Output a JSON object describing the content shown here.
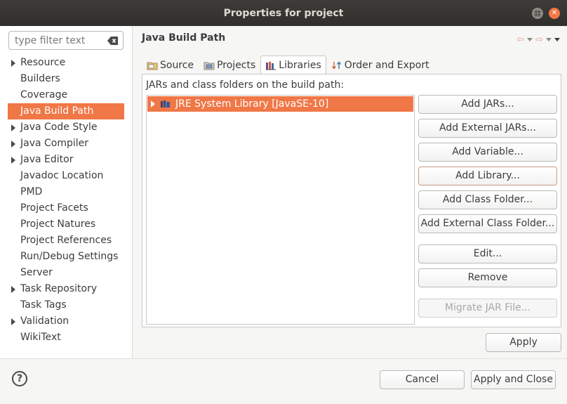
{
  "window": {
    "title": "Properties for project"
  },
  "filter": {
    "placeholder": "type filter text"
  },
  "nav": {
    "items": [
      {
        "label": "Resource",
        "expandable": true
      },
      {
        "label": "Builders",
        "expandable": false
      },
      {
        "label": "Coverage",
        "expandable": false
      },
      {
        "label": "Java Build Path",
        "expandable": false,
        "selected": true
      },
      {
        "label": "Java Code Style",
        "expandable": true
      },
      {
        "label": "Java Compiler",
        "expandable": true
      },
      {
        "label": "Java Editor",
        "expandable": true
      },
      {
        "label": "Javadoc Location",
        "expandable": false
      },
      {
        "label": "PMD",
        "expandable": false
      },
      {
        "label": "Project Facets",
        "expandable": false
      },
      {
        "label": "Project Natures",
        "expandable": false
      },
      {
        "label": "Project References",
        "expandable": false
      },
      {
        "label": "Run/Debug Settings",
        "expandable": false
      },
      {
        "label": "Server",
        "expandable": false
      },
      {
        "label": "Task Repository",
        "expandable": true
      },
      {
        "label": "Task Tags",
        "expandable": false
      },
      {
        "label": "Validation",
        "expandable": true
      },
      {
        "label": "WikiText",
        "expandable": false
      }
    ]
  },
  "page": {
    "title": "Java Build Path"
  },
  "tabs": {
    "source": "Source",
    "projects": "Projects",
    "libraries": "Libraries",
    "order": "Order and Export"
  },
  "libraries": {
    "label": "JARs and class folders on the build path:",
    "entries": [
      "JRE System Library [JavaSE-10]"
    ]
  },
  "buttons": {
    "add_jars": "Add JARs...",
    "add_external_jars": "Add External JARs...",
    "add_variable": "Add Variable...",
    "add_library": "Add Library...",
    "add_class_folder": "Add Class Folder...",
    "add_external_class_folder": "Add External Class Folder...",
    "edit": "Edit...",
    "remove": "Remove",
    "migrate_jar": "Migrate JAR File...",
    "apply": "Apply",
    "cancel": "Cancel",
    "apply_and_close": "Apply and Close"
  },
  "icons": {
    "help": "?"
  },
  "colors": {
    "accent": "#f07746",
    "titlebar": "#35342f"
  }
}
